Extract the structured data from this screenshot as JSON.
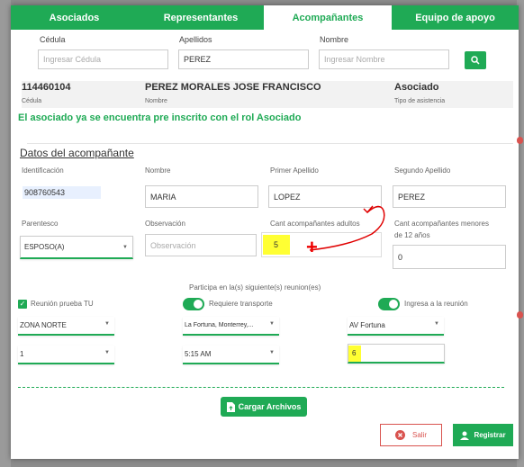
{
  "tabs": [
    {
      "label": "Asociados"
    },
    {
      "label": "Representantes"
    },
    {
      "label": "Acompañantes"
    },
    {
      "label": "Equipo de apoyo"
    }
  ],
  "search": {
    "cedula_label": "Cédula",
    "cedula_placeholder": "Ingresar Cédula",
    "apellidos_label": "Apellidos",
    "apellidos_value": "PEREZ",
    "nombre_label": "Nombre",
    "nombre_placeholder": "Ingresar Nombre"
  },
  "associate": {
    "cedula": "114460104",
    "cedula_label": "Cédula",
    "nombre": "PEREZ MORALES JOSE FRANCISCO",
    "nombre_label": "Nombre",
    "tipo": "Asociado",
    "tipo_label": "Tipo de asistencia"
  },
  "notice": "El asociado ya se encuentra pre inscrito con el rol Asociado",
  "section_title": "Datos del acompañante",
  "form": {
    "identificacion_label": "Identificación",
    "identificacion_value": "908760543",
    "nombre_label": "Nombre",
    "nombre_value": "MARIA",
    "primer_apellido_label": "Primer Apellido",
    "primer_apellido_value": "LOPEZ",
    "segundo_apellido_label": "Segundo Apellido",
    "segundo_apellido_value": "PEREZ",
    "parentesco_label": "Parentesco",
    "parentesco_value": "ESPOSO(A)",
    "observacion_label": "Observación",
    "observacion_placeholder": "Observación",
    "adultos_label": "Cant acompañantes adultos",
    "adultos_value": "5",
    "menores_label_1": "Cant acompañantes menores",
    "menores_label_2": "de 12 años",
    "menores_value": "0"
  },
  "participa_label": "Participa en la(s) siguiente(s) reunion(es)",
  "reunion": {
    "checkbox_label": "Reunión prueba TU",
    "transporte_label": "Requiere transporte",
    "ingresa_label": "Ingresa a la reunión",
    "zona_value": "ZONA NORTE",
    "lugar_value": "La Fortuna, Monterrey,...",
    "av_value": "AV Fortuna",
    "num_value": "1",
    "hora_value": "5:15 AM",
    "input_value": "6"
  },
  "buttons": {
    "cargar": "Cargar Archivos",
    "salir": "Salir",
    "registrar": "Registrar"
  },
  "colors": {
    "accent": "#1faa55",
    "danger": "#d9534f",
    "highlight": "#ffff33",
    "annotation": "#e00000"
  }
}
